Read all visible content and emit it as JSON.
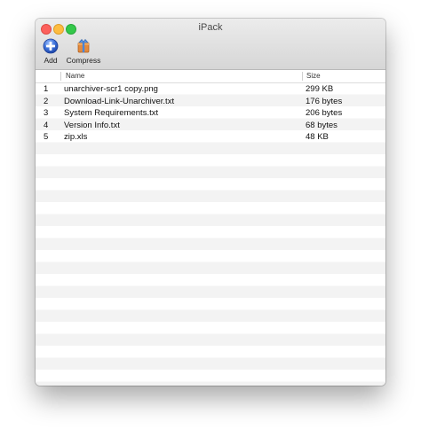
{
  "window": {
    "title": "iPack"
  },
  "toolbar": {
    "add_label": "Add",
    "compress_label": "Compress"
  },
  "table": {
    "columns": {
      "name": "Name",
      "size": "Size"
    },
    "rows": [
      {
        "index": "1",
        "name": "unarchiver-scr1 copy.png",
        "size": "299 KB"
      },
      {
        "index": "2",
        "name": "Download-Link-Unarchiver.txt",
        "size": "176 bytes"
      },
      {
        "index": "3",
        "name": "System Requirements.txt",
        "size": "206 bytes"
      },
      {
        "index": "4",
        "name": "Version Info.txt",
        "size": "68 bytes"
      },
      {
        "index": "5",
        "name": "zip.xls",
        "size": "48 KB"
      }
    ]
  },
  "colors": {
    "close": "#fc605c",
    "minimize": "#fdbc40",
    "maximize": "#34c84a",
    "add_icon": "#3a6fd8",
    "stripe": "#f3f3f3"
  },
  "icons": {
    "add": "add-icon",
    "compress": "compress-icon"
  }
}
